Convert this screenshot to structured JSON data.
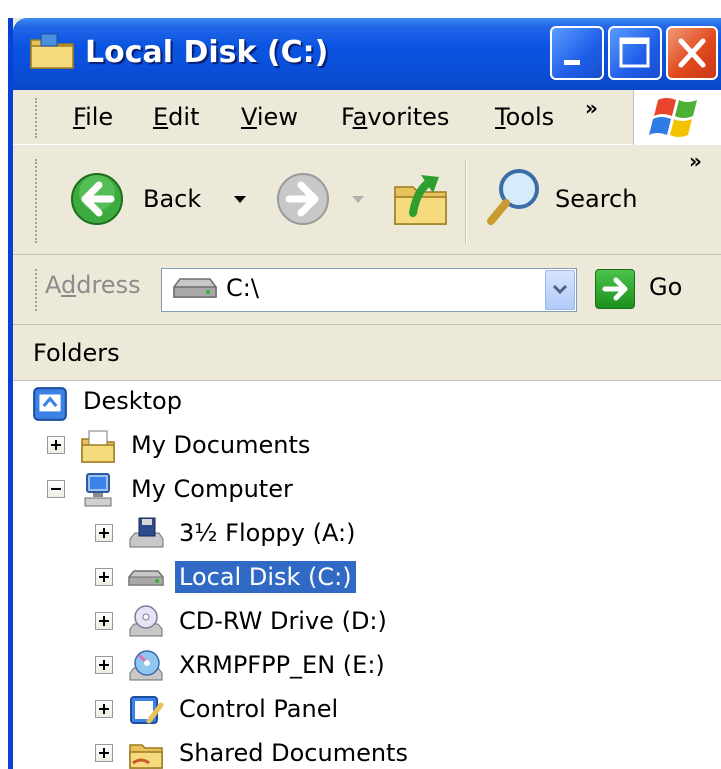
{
  "window": {
    "title": "Local Disk (C:)"
  },
  "menubar": {
    "items": [
      {
        "key": "F",
        "rest": "ile"
      },
      {
        "key": "E",
        "rest": "dit"
      },
      {
        "key": "V",
        "rest": "iew"
      },
      {
        "pre": "F",
        "key": "a",
        "rest": "vorites"
      },
      {
        "key": "T",
        "rest": "ools"
      }
    ],
    "overflow": "»"
  },
  "toolbar": {
    "back_label": "Back",
    "search_label": "Search",
    "overflow": "»"
  },
  "address": {
    "label_pre": "A",
    "label_key": "d",
    "label_rest": "dress",
    "value": "C:\\",
    "go_label": "Go"
  },
  "folders": {
    "header": "Folders"
  },
  "tree": {
    "desktop": "Desktop",
    "my_documents": "My Documents",
    "my_computer": "My Computer",
    "floppy": "3½ Floppy (A:)",
    "local_disk": "Local Disk (C:)",
    "cdrw": "CD-RW Drive (D:)",
    "xrmpfpp": "XRMPFPP_EN (E:)",
    "control_panel": "Control Panel",
    "shared_documents": "Shared Documents"
  },
  "colors": {
    "titlebar": "#0A54E2",
    "selection": "#316AC5",
    "chrome": "#ECE9D8"
  }
}
